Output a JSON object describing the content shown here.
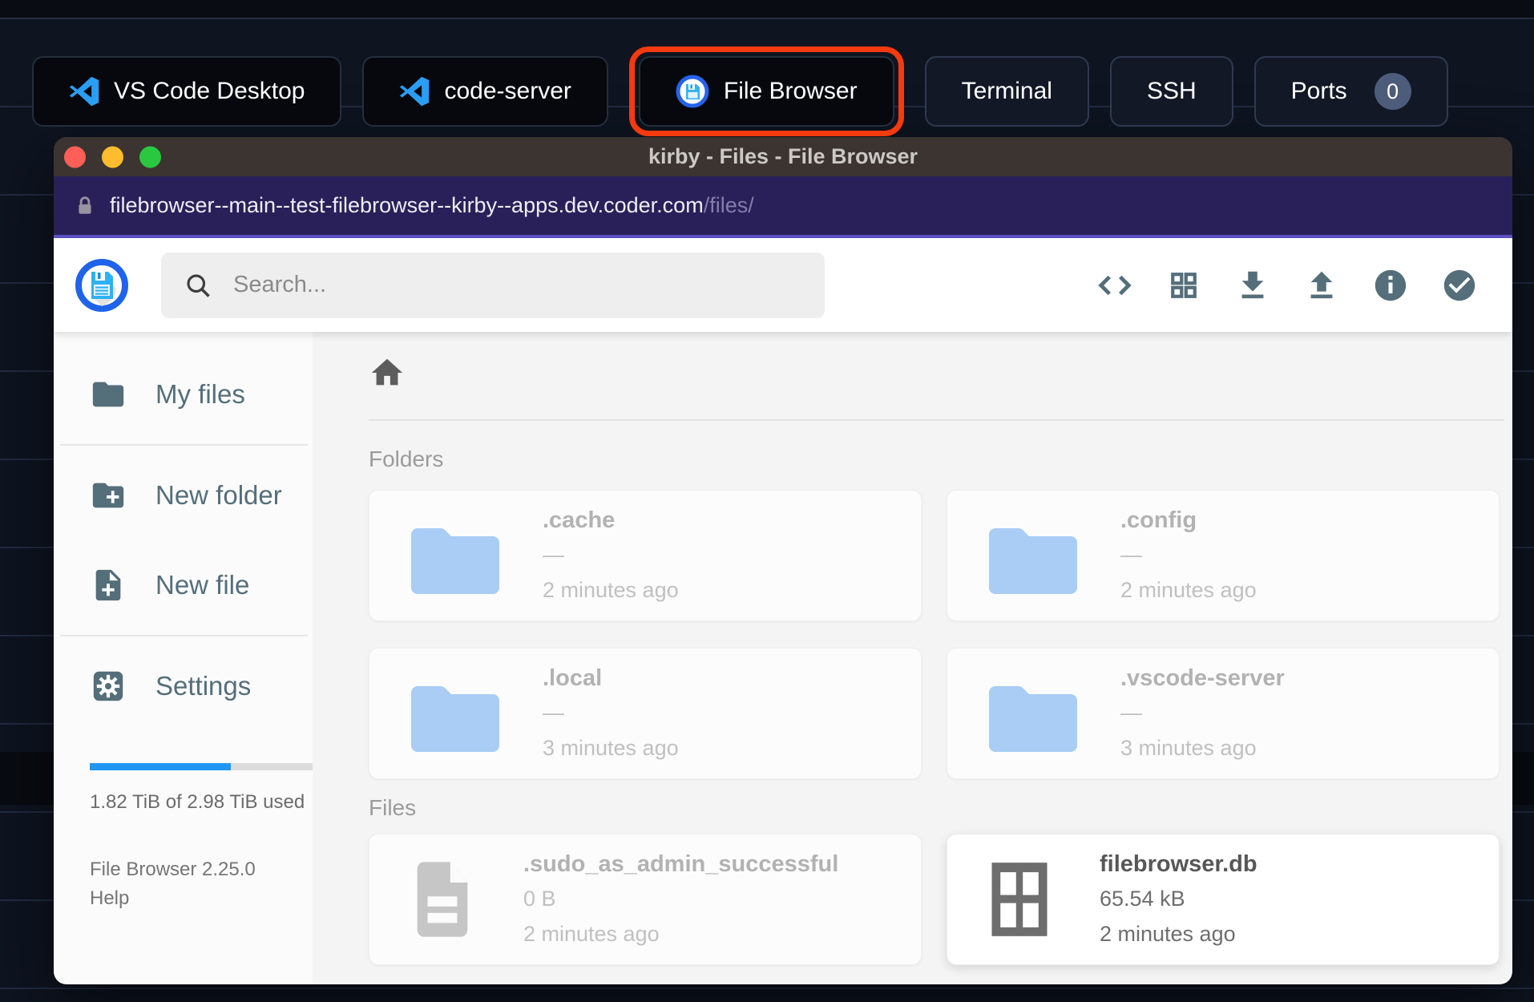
{
  "taskbar": {
    "buttons": [
      {
        "label": "VS Code Desktop"
      },
      {
        "label": "code-server"
      },
      {
        "label": "File Browser"
      },
      {
        "label": "Terminal"
      },
      {
        "label": "SSH"
      },
      {
        "label": "Ports",
        "badge": "0"
      }
    ]
  },
  "window": {
    "title": "kirby - Files - File Browser",
    "url": {
      "host": "filebrowser--main--test-filebrowser--kirby--apps.dev.coder.com",
      "path": "/files/"
    }
  },
  "toolbar": {
    "search_placeholder": "Search..."
  },
  "sidebar": {
    "items": [
      {
        "label": "My files"
      },
      {
        "label": "New folder"
      },
      {
        "label": "New file"
      },
      {
        "label": "Settings"
      }
    ],
    "usage": {
      "text": "1.82 TiB of 2.98 TiB used",
      "percent_used": 61
    },
    "version": "File Browser 2.25.0",
    "help": "Help"
  },
  "content": {
    "folders": {
      "label": "Folders",
      "items": [
        {
          "name": ".cache",
          "size": "—",
          "modified": "2 minutes ago"
        },
        {
          "name": ".config",
          "size": "—",
          "modified": "2 minutes ago"
        },
        {
          "name": ".local",
          "size": "—",
          "modified": "3 minutes ago"
        },
        {
          "name": ".vscode-server",
          "size": "—",
          "modified": "3 minutes ago"
        }
      ]
    },
    "files": {
      "label": "Files",
      "items": [
        {
          "name": ".sudo_as_admin_successful",
          "size": "0 B",
          "modified": "2 minutes ago"
        },
        {
          "name": "filebrowser.db",
          "size": "65.54 kB",
          "modified": "2 minutes ago"
        }
      ]
    }
  },
  "colors": {
    "accent_blue": "#2196f3",
    "highlight_red": "#f43a0e",
    "slate_icon": "#546e7a",
    "folder_blue": "#a9cdf4",
    "url_bar": "#2a2059"
  }
}
